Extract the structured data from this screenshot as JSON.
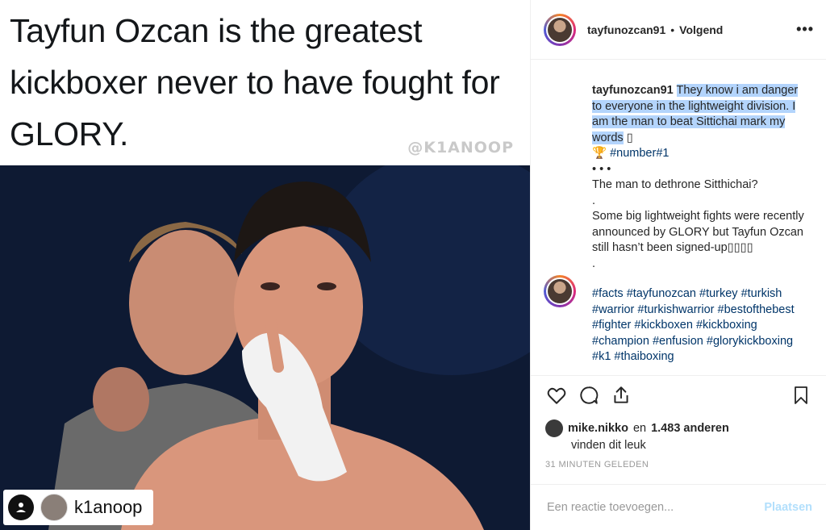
{
  "media": {
    "tweet_text": "Tayfun Ozcan is the greatest kickboxer never to have fought for GLORY.",
    "watermark": "@K1ANOOP",
    "repost_username": "k1anoop"
  },
  "header": {
    "username": "tayfunozcan91",
    "separator": "•",
    "follow_status": "Volgend",
    "more": "•••"
  },
  "caption": {
    "username": "tayfunozcan91",
    "highlighted": "They know i am danger to everyone in the lightweight division. I am the man to beat Sittichai mark my words",
    "emoji_box": "▯",
    "trophy": "🏆",
    "hashtag_number": "#number#1",
    "dots": "• • •",
    "line2": "The man to dethrone Sitthichai?",
    "dot1": ".",
    "line3": "Some big lightweight fights were recently announced by GLORY but Tayfun Ozcan still hasn’t been signed-up▯▯▯▯",
    "dot2": "."
  },
  "hashtags": "#facts #tayfunozcan #turkey #turkish #warrior #turkishwarrior #bestofthebest #fighter #kickboxen #kickboxing #champion #enfusion #glorykickboxing #k1 #thaiboxing",
  "likes": {
    "user": "mike.nikko",
    "and": "en",
    "count": "1.483 anderen",
    "suffix": "vinden dit leuk"
  },
  "timestamp": "31 MINUTEN GELEDEN",
  "comment_box": {
    "placeholder": "Een reactie toevoegen...",
    "post_label": "Plaatsen"
  },
  "colors": {
    "hashtag": "#003569",
    "highlight": "#b3d4fc",
    "post_disabled": "#b2dffc"
  }
}
